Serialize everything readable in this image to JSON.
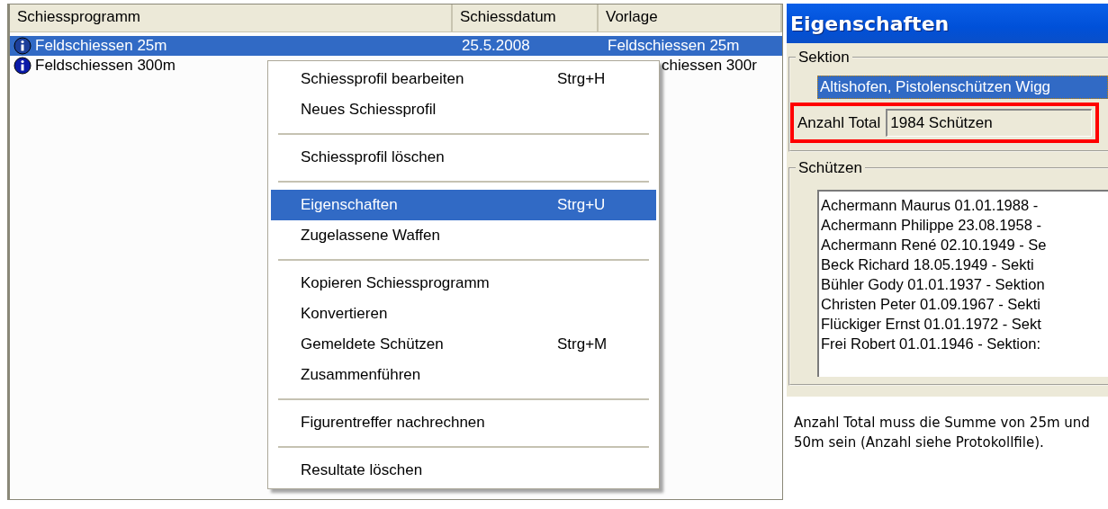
{
  "list": {
    "columns": [
      "Schiessprogramm",
      "Schiessdatum",
      "Vorlage"
    ],
    "rows": [
      {
        "selected": true,
        "cells": [
          "Feldschiessen 25m",
          "25.5.2008",
          "Feldschiessen 25m"
        ]
      },
      {
        "selected": false,
        "cells": [
          "Feldschiessen 300m",
          "",
          "chiessen 300r"
        ]
      }
    ]
  },
  "context_menu": [
    {
      "kind": "item",
      "label": "Schiessprofil bearbeiten",
      "shortcut": "Strg+H",
      "selected": false
    },
    {
      "kind": "item",
      "label": "Neues Schiessprofil",
      "selected": false
    },
    {
      "kind": "separator"
    },
    {
      "kind": "item",
      "label": "Schiessprofil löschen",
      "selected": false
    },
    {
      "kind": "separator"
    },
    {
      "kind": "item",
      "label": "Eigenschaften",
      "shortcut": "Strg+U",
      "selected": true
    },
    {
      "kind": "item",
      "label": "Zugelassene Waffen",
      "selected": false
    },
    {
      "kind": "separator"
    },
    {
      "kind": "item",
      "label": "Kopieren Schiessprogramm",
      "selected": false
    },
    {
      "kind": "item",
      "label": "Konvertieren",
      "selected": false
    },
    {
      "kind": "item",
      "label": "Gemeldete Schützen",
      "shortcut": "Strg+M",
      "selected": false
    },
    {
      "kind": "item",
      "label": "Zusammenführen",
      "selected": false
    },
    {
      "kind": "separator"
    },
    {
      "kind": "item",
      "label": "Figurentreffer nachrechnen",
      "selected": false
    },
    {
      "kind": "separator"
    },
    {
      "kind": "item",
      "label": "Resultate löschen",
      "selected": false
    }
  ],
  "dialog": {
    "title": "Eigenschaften",
    "sektion": {
      "legend": "Sektion",
      "value": "Altishofen, Pistolenschützen Wigg",
      "total_label": "Anzahl Total",
      "total_value": "1984 Schützen"
    },
    "schuetzen": {
      "legend": "Schützen",
      "items": [
        "Achermann Maurus 01.01.1988 -",
        "Achermann Philippe 23.08.1958 -",
        "Achermann René 02.10.1949 - Se",
        "Beck Richard 18.05.1949 - Sekti",
        "Bühler Gody 01.01.1937 - Sektion",
        "Christen Peter 01.09.1967 - Sekti",
        "Flückiger Ernst 01.01.1972 - Sekt",
        "Frei Robert 01.01.1946 - Sektion:"
      ]
    }
  },
  "note": "Anzahl Total muss die Summe von 25m und 50m sein (Anzahl siehe Protokollfile)."
}
